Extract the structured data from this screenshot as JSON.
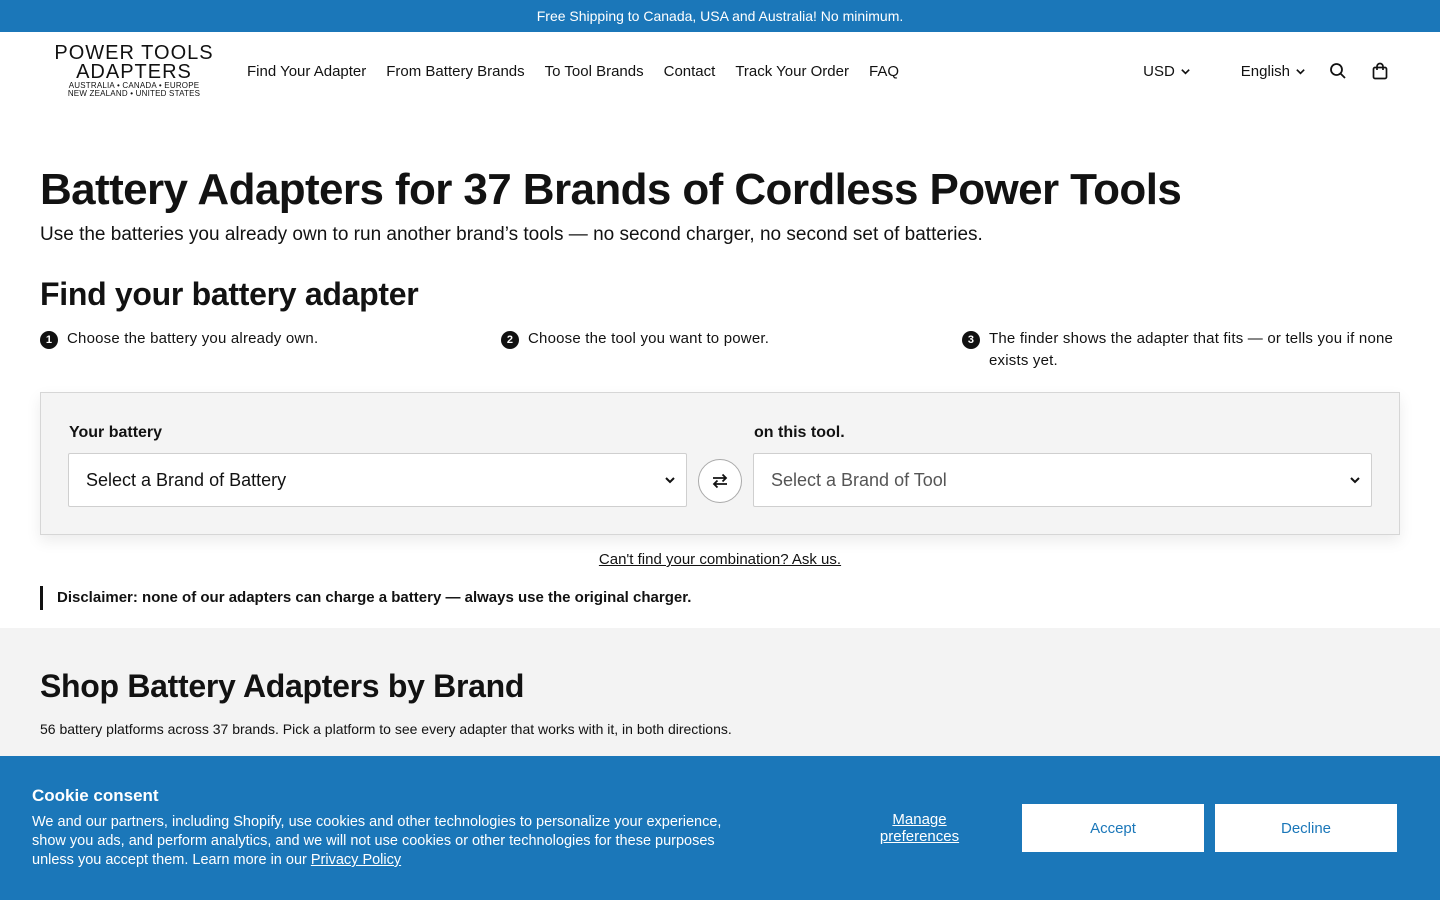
{
  "announcement": "Free Shipping to Canada, USA and Australia! No minimum.",
  "logo": {
    "line1": "POWER TOOLS",
    "line2": "ADAPTERS",
    "sub1": "AUSTRALIA • CANADA • EUROPE",
    "sub2": "NEW ZEALAND • UNITED STATES"
  },
  "nav": [
    "Find Your Adapter",
    "From Battery Brands",
    "To Tool Brands",
    "Contact",
    "Track Your Order",
    "FAQ"
  ],
  "utils": {
    "currency": "USD",
    "language": "English",
    "icons": [
      "search-icon",
      "cart-icon"
    ]
  },
  "hero": {
    "title": "Battery Adapters for 37 Brands of Cordless Power Tools",
    "subtitle": "Use the batteries you already own to run another brand’s tools — no second charger, no second set of batteries.",
    "finder_heading": "Find your battery adapter"
  },
  "steps": [
    {
      "num": "1",
      "text": "Choose the battery you already own."
    },
    {
      "num": "2",
      "text": "Choose the tool you want to power."
    },
    {
      "num": "3",
      "text": "The finder shows the adapter that fits — or tells you if none exists yet."
    }
  ],
  "finder": {
    "battery_label": "Your battery",
    "battery_select": "Select a Brand of Battery",
    "tool_label": "on this tool.",
    "tool_select": "Select a Brand of Tool",
    "swap_icon": "swap-arrows-icon"
  },
  "ask_link": "Can't find your combination? Ask us.",
  "disclaimer": "Disclaimer: none of our adapters can charge a battery — always use the original charger.",
  "shop": {
    "title": "Shop Battery Adapters by Brand",
    "subtitle": "56 battery platforms across 37 brands. Pick a platform to see every adapter that works with it, in both directions."
  },
  "cookie": {
    "title": "Cookie consent",
    "text": "We and our partners, including Shopify, use cookies and other technologies to personalize your experience, show you ads, and perform analytics, and we will not use cookies or other technologies for these purposes unless you accept them. Learn more in our",
    "privacy_link": "Privacy Policy",
    "manage": "Manage preferences",
    "accept": "Accept",
    "decline": "Decline"
  },
  "colors": {
    "brand_blue": "#1b77b9",
    "text": "#121212",
    "finder_bg": "#f4f4f4",
    "shop_bg": "#f3f3f3"
  }
}
